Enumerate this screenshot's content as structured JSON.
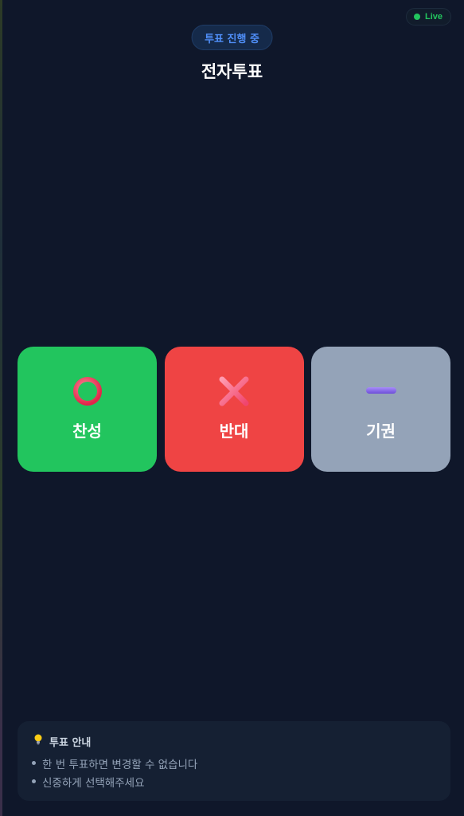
{
  "header": {
    "live_label": "Live",
    "status_label": "투표 진행 중",
    "title": "전자투표"
  },
  "votes": [
    {
      "label": "찬성",
      "icon": "circle-o-icon",
      "color": "#22c55e"
    },
    {
      "label": "반대",
      "icon": "cross-x-icon",
      "color": "#ef4444"
    },
    {
      "label": "기권",
      "icon": "minus-dash-icon",
      "color": "#94a3b8"
    }
  ],
  "guide": {
    "icon": "lightbulb-icon",
    "title": "투표 안내",
    "items": [
      "한 번 투표하면 변경할 수 없습니다",
      "신중하게 선택해주세요"
    ]
  },
  "colors": {
    "background": "#0f172a",
    "live": "#22c55e",
    "status_text": "#4f8ef7"
  }
}
